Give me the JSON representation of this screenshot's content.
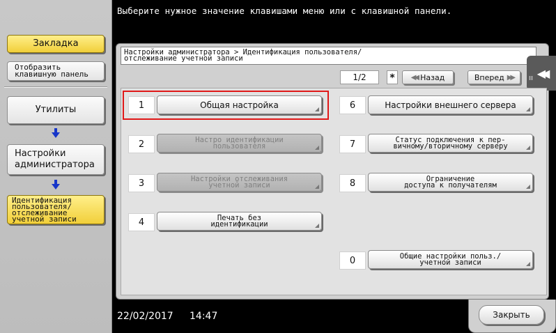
{
  "top_message": "Выберите нужное значение клавишами меню или с клавишной панели.",
  "sidebar": {
    "bookmark": "Закладка",
    "show_keypad": "Отобразить клавишную панель",
    "utilities": "Утилиты",
    "admin_settings": "Настройки администратора",
    "user_auth": "Идентификация пользователя/ отслеживание учетной записи"
  },
  "path": {
    "line1": "Настройки администратора > Идентификация пользователя/",
    "line2": "отслеживание учетной записи"
  },
  "pager": {
    "page": "1/2",
    "star": "*",
    "back": "Назад",
    "forward": "Вперед"
  },
  "menu": [
    {
      "num": "1",
      "label": "Общая настройка",
      "enabled": true
    },
    {
      "num": "2",
      "label": "Настро   идентификации\nпользователя",
      "enabled": false
    },
    {
      "num": "3",
      "label": "Настройки отслеживания\nучетной записи",
      "enabled": false
    },
    {
      "num": "4",
      "label": "Печать без\nидентификации",
      "enabled": true
    },
    {
      "num": "6",
      "label": "Настройки внешнего сервера",
      "enabled": true
    },
    {
      "num": "7",
      "label": "Статус подключения к пер-\nвичному/вторичному серверу",
      "enabled": true
    },
    {
      "num": "8",
      "label": "Ограничение\nдоступа к получателям",
      "enabled": true
    },
    {
      "num": "0",
      "label": "Общие настройки польз./\nучетной записи",
      "enabled": true
    }
  ],
  "status": {
    "date": "22/02/2017",
    "time": "14:47",
    "close": "Закрыть"
  },
  "colors": {
    "highlight": "#e01818",
    "bookmark_yellow": "#f1cf3a",
    "arrow_blue": "#1736c9"
  }
}
